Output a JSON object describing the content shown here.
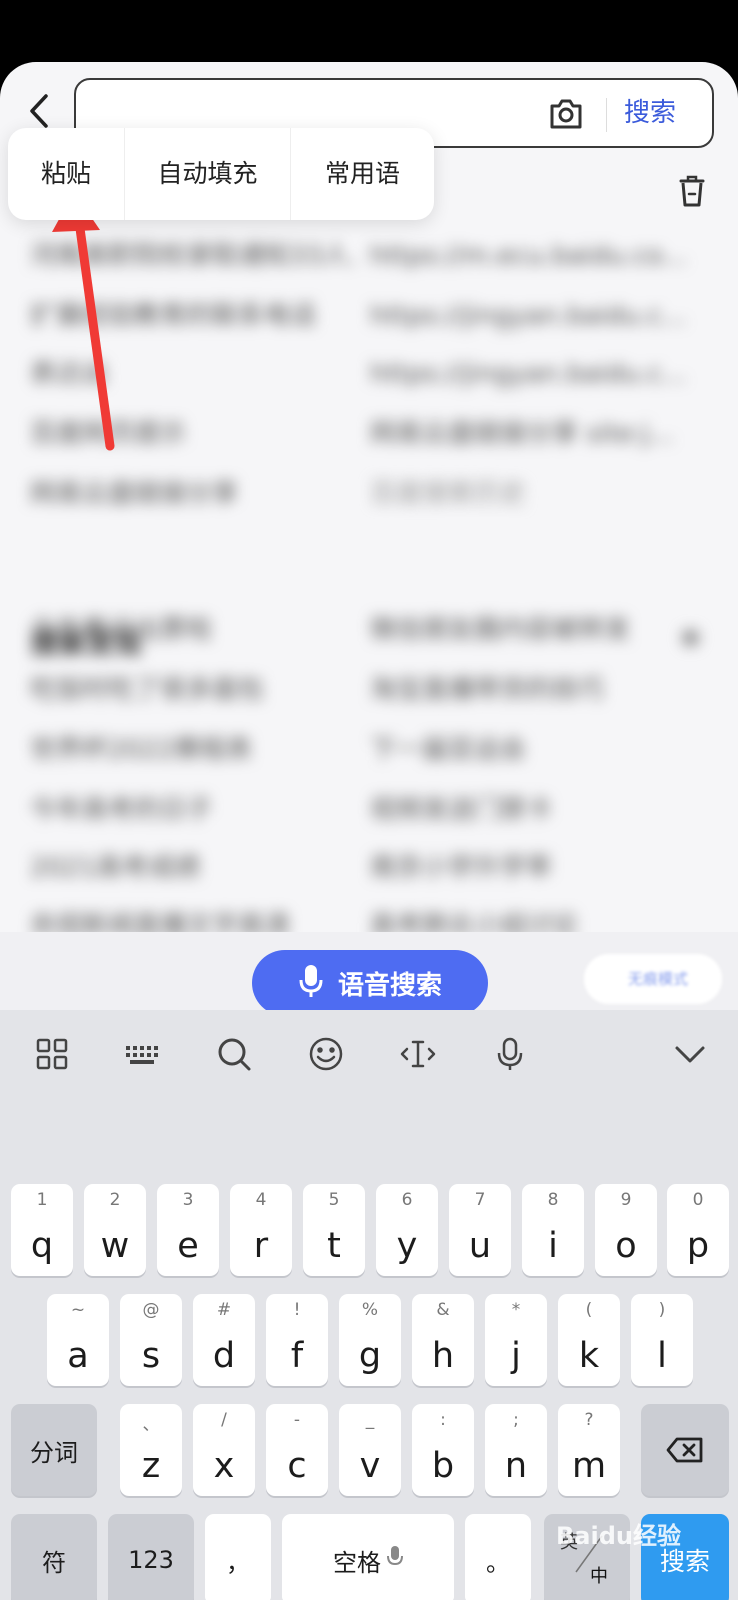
{
  "search": {
    "placeholder": "",
    "submit_label": "搜索"
  },
  "paste_popup": {
    "paste": "粘贴",
    "autofill": "自动填充",
    "phrases": "常用语"
  },
  "history_rows": [
    [
      "河南高职院校录取通知33人...",
      "https://m.ecu.baidu.co..."
    ],
    [
      "扩展经验教育的联系电话",
      "https://jingyan.baidu.c..."
    ],
    [
      "表达出",
      "https://jingyan.baidu.c..."
    ],
    [
      "百度网页提示",
      "网易云盘链接分享 site:j..."
    ],
    [
      "网易云盘链接分享",
      "百度搜索历史"
    ]
  ],
  "hot_search": {
    "title": "搜索发现",
    "rows": [
      [
        "今年春运出票啦",
        "微信朋友圈内容被转发"
      ],
      [
        "吃饭时吃了很多面包",
        "淘宝直播带货的技巧"
      ],
      [
        "世界杯2022赛程表",
        "下一届亚运会"
      ],
      [
        "今年高考的日子",
        "视频发送门禁卡"
      ],
      [
        "2021高考成绩",
        "南京小学升学率"
      ],
      [
        "央视新闻直播文字高清",
        "高考肺炎小组讨论"
      ]
    ]
  },
  "voice": {
    "label": "语音搜索",
    "mode_label": "无痕模式"
  },
  "keyboard": {
    "row1": [
      {
        "hint": "1",
        "key": "q"
      },
      {
        "hint": "2",
        "key": "w"
      },
      {
        "hint": "3",
        "key": "e"
      },
      {
        "hint": "4",
        "key": "r"
      },
      {
        "hint": "5",
        "key": "t"
      },
      {
        "hint": "6",
        "key": "y"
      },
      {
        "hint": "7",
        "key": "u"
      },
      {
        "hint": "8",
        "key": "i"
      },
      {
        "hint": "9",
        "key": "o"
      },
      {
        "hint": "0",
        "key": "p"
      }
    ],
    "row2": [
      {
        "hint": "~",
        "key": "a"
      },
      {
        "hint": "@",
        "key": "s"
      },
      {
        "hint": "#",
        "key": "d"
      },
      {
        "hint": "!",
        "key": "f"
      },
      {
        "hint": "%",
        "key": "g"
      },
      {
        "hint": "&",
        "key": "h"
      },
      {
        "hint": "*",
        "key": "j"
      },
      {
        "hint": "(",
        "key": "k"
      },
      {
        "hint": ")",
        "key": "l"
      }
    ],
    "row3": [
      {
        "hint": "、",
        "key": "z"
      },
      {
        "hint": "/",
        "key": "x"
      },
      {
        "hint": "-",
        "key": "c"
      },
      {
        "hint": "_",
        "key": "v"
      },
      {
        "hint": ":",
        "key": "b"
      },
      {
        "hint": ";",
        "key": "n"
      },
      {
        "hint": "?",
        "key": "m"
      }
    ],
    "segment": "分词",
    "symbols": "符",
    "numbers": "123",
    "comma": "，",
    "space": "空格",
    "period": "。",
    "lang_top": "英",
    "lang_bottom": "中",
    "search": "搜索"
  },
  "watermark": "Baidu经验",
  "colors": {
    "accent": "#4e6cf2",
    "search_text": "#3b5bdb",
    "search_key": "#2f9bf0",
    "arrow": "#f03a35"
  }
}
